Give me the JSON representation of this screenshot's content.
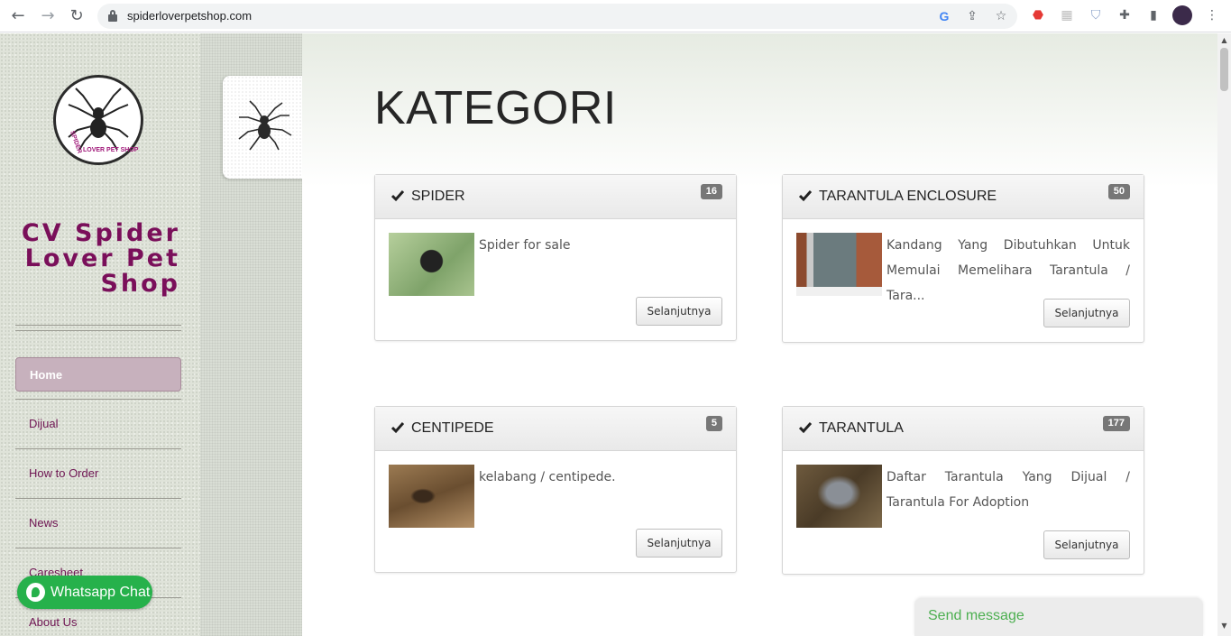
{
  "browser": {
    "url": "spiderloverpetshop.com",
    "icons": [
      "back-icon",
      "forward-icon",
      "reload-icon",
      "lock-icon",
      "google-icon",
      "share-icon",
      "star-icon",
      "extension-icons",
      "puzzle-icon",
      "sidepanel-icon",
      "profile-avatar",
      "menu-icon"
    ]
  },
  "sidebar": {
    "site_title": "CV Spider Lover Pet Shop",
    "logo_text": "SPIDER LOVER PET SHOP .com",
    "menu": [
      {
        "label": "Home",
        "active": true
      },
      {
        "label": "Dijual"
      },
      {
        "label": "How to Order"
      },
      {
        "label": "News"
      },
      {
        "label": "Caresheet"
      },
      {
        "label": "About Us"
      }
    ]
  },
  "whatsapp": {
    "label": "Whatsapp Chat"
  },
  "main": {
    "title": "KATEGORI",
    "categories": [
      {
        "title": "SPIDER",
        "count": "16",
        "desc": "Spider for sale",
        "button": "Selanjutnya"
      },
      {
        "title": "TARANTULA ENCLOSURE",
        "count": "50",
        "desc": "Kandang Yang Dibutuhkan Untuk Memulai Memelihara Tarantula / Tara...",
        "button": "Selanjutnya"
      },
      {
        "title": "CENTIPEDE",
        "count": "5",
        "desc": "kelabang / centipede.",
        "button": "Selanjutnya"
      },
      {
        "title": "TARANTULA",
        "count": "177",
        "desc": "Daftar Tarantula Yang Dijual / Tarantula For Adoption",
        "button": "Selanjutnya"
      }
    ]
  },
  "chat": {
    "send_message": "Send message"
  },
  "colors": {
    "brand": "#7a0f5a",
    "whatsapp": "#26b14b",
    "badge": "#777777"
  }
}
